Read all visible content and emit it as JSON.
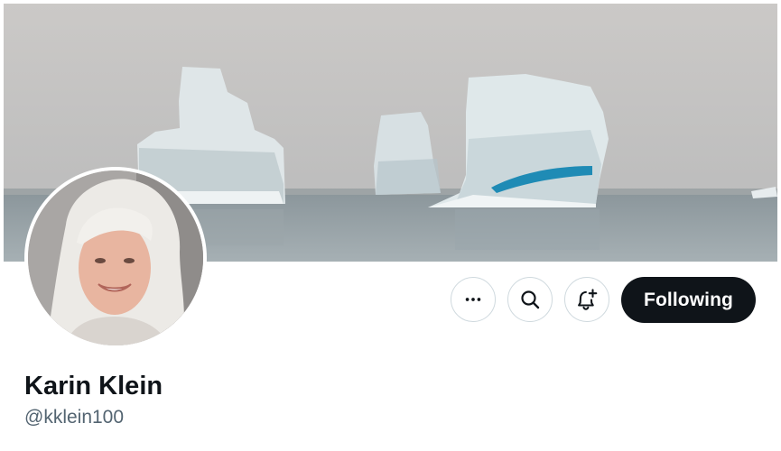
{
  "banner": {
    "image": "icebergs-in-fog-photo"
  },
  "avatar": {
    "image": "profile-photo"
  },
  "actions": {
    "more_icon": "more-dots-icon",
    "search_icon": "search-icon",
    "notify_icon": "bell-plus-icon",
    "following_label": "Following"
  },
  "profile": {
    "display_name": "Karin Klein",
    "handle": "@kklein100"
  },
  "colors": {
    "primary_text": "#0f1419",
    "secondary_text": "#536471",
    "button_dark": "#0f1419",
    "button_border": "#cfd9de"
  }
}
